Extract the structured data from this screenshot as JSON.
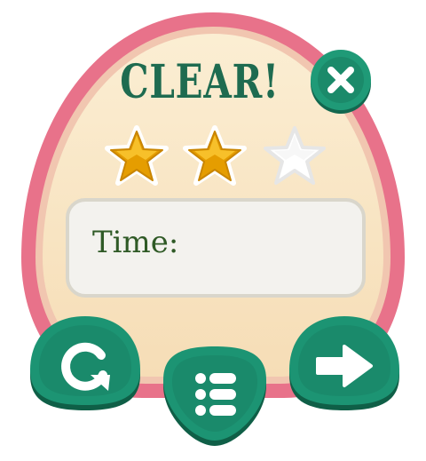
{
  "dialog": {
    "title": "CLEAR!",
    "stars_earned": 2,
    "stars_total": 3,
    "time_label": "Time:",
    "time_value": ""
  },
  "buttons": {
    "close_icon": "close-x-icon",
    "retry_icon": "restart-arrow-icon",
    "menu_icon": "level-list-icon",
    "next_icon": "right-arrow-icon"
  },
  "colors": {
    "egg_outer": "#e8728a",
    "egg_inner": "#f7e3c0",
    "title": "#1e6b50",
    "button": "#1a8f70",
    "star_gold": "#f0b400",
    "star_empty": "#ffffff"
  }
}
